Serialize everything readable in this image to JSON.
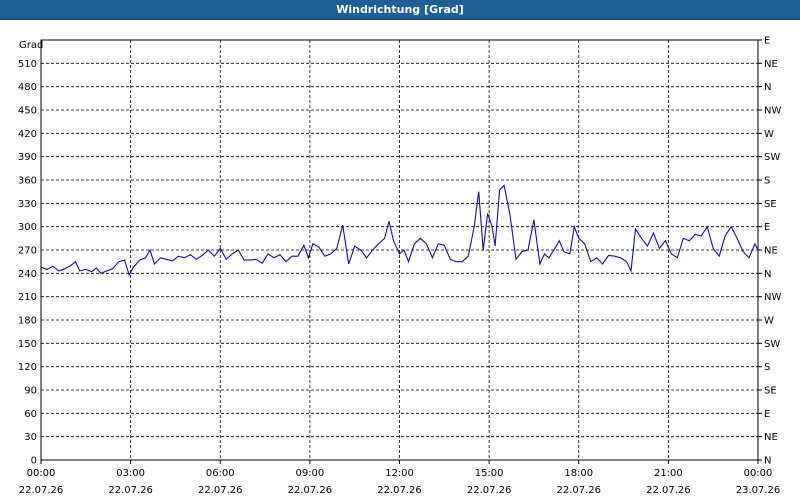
{
  "window": {
    "title": "Windrichtung [Grad]"
  },
  "chart_data": {
    "type": "line",
    "title": "Windrichtung [Grad]",
    "ylabel": "Grad",
    "ylim": [
      0,
      540
    ],
    "grid": true,
    "y_ticks": [
      0,
      30,
      60,
      90,
      120,
      150,
      180,
      210,
      240,
      270,
      300,
      330,
      360,
      390,
      420,
      450,
      480,
      510
    ],
    "y_right_ticks": [
      {
        "value": 0,
        "label": "N"
      },
      {
        "value": 30,
        "label": "NE"
      },
      {
        "value": 60,
        "label": "E"
      },
      {
        "value": 90,
        "label": "SE"
      },
      {
        "value": 120,
        "label": "S"
      },
      {
        "value": 150,
        "label": "SW"
      },
      {
        "value": 180,
        "label": "W"
      },
      {
        "value": 210,
        "label": "NW"
      },
      {
        "value": 240,
        "label": "N"
      },
      {
        "value": 270,
        "label": "NE"
      },
      {
        "value": 300,
        "label": "E"
      },
      {
        "value": 330,
        "label": "SE"
      },
      {
        "value": 360,
        "label": "S"
      },
      {
        "value": 390,
        "label": "SW"
      },
      {
        "value": 420,
        "label": "W"
      },
      {
        "value": 450,
        "label": "NW"
      },
      {
        "value": 480,
        "label": "N"
      },
      {
        "value": 510,
        "label": "NE"
      },
      {
        "value": 540,
        "label": "E"
      }
    ],
    "x_ticks": [
      {
        "value": 0,
        "time": "00:00",
        "date": "22.07.26"
      },
      {
        "value": 3,
        "time": "03:00",
        "date": "22.07.26"
      },
      {
        "value": 6,
        "time": "06:00",
        "date": "22.07.26"
      },
      {
        "value": 9,
        "time": "09:00",
        "date": "22.07.26"
      },
      {
        "value": 12,
        "time": "12:00",
        "date": "22.07.26"
      },
      {
        "value": 15,
        "time": "15:00",
        "date": "22.07.26"
      },
      {
        "value": 18,
        "time": "18:00",
        "date": "22.07.26"
      },
      {
        "value": 21,
        "time": "21:00",
        "date": "22.07.26"
      },
      {
        "value": 24,
        "time": "00:00",
        "date": "23.07.26"
      }
    ],
    "xlim": [
      0,
      24
    ],
    "series": [
      {
        "color": "#1010a0",
        "points": [
          [
            0.0,
            248
          ],
          [
            0.2,
            245
          ],
          [
            0.4,
            249
          ],
          [
            0.6,
            243
          ],
          [
            0.8,
            246
          ],
          [
            1.0,
            250
          ],
          [
            1.15,
            255
          ],
          [
            1.3,
            243
          ],
          [
            1.5,
            245
          ],
          [
            1.7,
            242
          ],
          [
            1.85,
            247
          ],
          [
            2.0,
            240
          ],
          [
            2.2,
            243
          ],
          [
            2.4,
            246
          ],
          [
            2.6,
            255
          ],
          [
            2.8,
            257
          ],
          [
            2.95,
            238
          ],
          [
            3.1,
            248
          ],
          [
            3.3,
            257
          ],
          [
            3.5,
            260
          ],
          [
            3.65,
            270
          ],
          [
            3.8,
            252
          ],
          [
            4.0,
            260
          ],
          [
            4.2,
            258
          ],
          [
            4.4,
            256
          ],
          [
            4.6,
            262
          ],
          [
            4.8,
            260
          ],
          [
            5.0,
            264
          ],
          [
            5.2,
            258
          ],
          [
            5.4,
            263
          ],
          [
            5.6,
            270
          ],
          [
            5.8,
            262
          ],
          [
            6.0,
            272
          ],
          [
            6.2,
            258
          ],
          [
            6.4,
            265
          ],
          [
            6.6,
            270
          ],
          [
            6.8,
            257
          ],
          [
            7.0,
            257
          ],
          [
            7.2,
            258
          ],
          [
            7.4,
            253
          ],
          [
            7.6,
            265
          ],
          [
            7.8,
            260
          ],
          [
            8.0,
            264
          ],
          [
            8.2,
            255
          ],
          [
            8.4,
            262
          ],
          [
            8.6,
            262
          ],
          [
            8.8,
            276
          ],
          [
            8.95,
            260
          ],
          [
            9.1,
            278
          ],
          [
            9.3,
            274
          ],
          [
            9.5,
            262
          ],
          [
            9.7,
            265
          ],
          [
            9.9,
            272
          ],
          [
            10.1,
            302
          ],
          [
            10.3,
            252
          ],
          [
            10.5,
            275
          ],
          [
            10.7,
            270
          ],
          [
            10.9,
            260
          ],
          [
            11.1,
            270
          ],
          [
            11.3,
            278
          ],
          [
            11.5,
            285
          ],
          [
            11.65,
            307
          ],
          [
            11.8,
            282
          ],
          [
            12.0,
            265
          ],
          [
            12.15,
            270
          ],
          [
            12.3,
            255
          ],
          [
            12.5,
            278
          ],
          [
            12.7,
            285
          ],
          [
            12.9,
            278
          ],
          [
            13.1,
            260
          ],
          [
            13.3,
            278
          ],
          [
            13.5,
            276
          ],
          [
            13.7,
            258
          ],
          [
            13.9,
            255
          ],
          [
            14.1,
            255
          ],
          [
            14.3,
            262
          ],
          [
            14.5,
            300
          ],
          [
            14.65,
            345
          ],
          [
            14.8,
            270
          ],
          [
            14.95,
            317
          ],
          [
            15.1,
            300
          ],
          [
            15.2,
            275
          ],
          [
            15.35,
            347
          ],
          [
            15.5,
            353
          ],
          [
            15.7,
            315
          ],
          [
            15.9,
            258
          ],
          [
            16.1,
            268
          ],
          [
            16.3,
            270
          ],
          [
            16.5,
            309
          ],
          [
            16.7,
            252
          ],
          [
            16.85,
            265
          ],
          [
            17.0,
            260
          ],
          [
            17.2,
            272
          ],
          [
            17.35,
            282
          ],
          [
            17.5,
            268
          ],
          [
            17.7,
            265
          ],
          [
            17.85,
            300
          ],
          [
            18.0,
            285
          ],
          [
            18.2,
            278
          ],
          [
            18.4,
            255
          ],
          [
            18.6,
            260
          ],
          [
            18.8,
            252
          ],
          [
            19.0,
            263
          ],
          [
            19.2,
            262
          ],
          [
            19.4,
            260
          ],
          [
            19.6,
            255
          ],
          [
            19.75,
            243
          ],
          [
            19.9,
            297
          ],
          [
            20.1,
            285
          ],
          [
            20.3,
            275
          ],
          [
            20.5,
            292
          ],
          [
            20.7,
            272
          ],
          [
            20.9,
            282
          ],
          [
            21.1,
            265
          ],
          [
            21.3,
            260
          ],
          [
            21.5,
            285
          ],
          [
            21.7,
            282
          ],
          [
            21.9,
            290
          ],
          [
            22.1,
            288
          ],
          [
            22.3,
            300
          ],
          [
            22.5,
            272
          ],
          [
            22.7,
            262
          ],
          [
            22.9,
            288
          ],
          [
            23.1,
            300
          ],
          [
            23.3,
            285
          ],
          [
            23.5,
            268
          ],
          [
            23.7,
            260
          ],
          [
            23.9,
            278
          ],
          [
            24.0,
            270
          ],
          [
            24.15,
            262
          ],
          [
            24.3,
            268
          ]
        ]
      }
    ]
  }
}
